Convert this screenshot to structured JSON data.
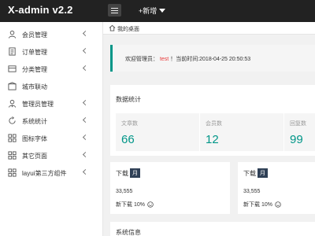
{
  "app": {
    "title": "X-admin v2.2",
    "add_new_label": "+新增"
  },
  "sidebar": {
    "items": [
      {
        "label": "会员管理",
        "icon": "user-icon"
      },
      {
        "label": "订单管理",
        "icon": "order-icon"
      },
      {
        "label": "分类管理",
        "icon": "category-icon"
      },
      {
        "label": "城市联动",
        "icon": "city-icon"
      },
      {
        "label": "管理员管理",
        "icon": "admin-icon"
      },
      {
        "label": "系统统计",
        "icon": "stats-icon"
      },
      {
        "label": "图标字体",
        "icon": "font-icon"
      },
      {
        "label": "其它页面",
        "icon": "pages-icon"
      },
      {
        "label": "layui第三方组件",
        "icon": "components-icon"
      }
    ]
  },
  "tabs": {
    "home_label": "我的桌面"
  },
  "welcome": {
    "prefix": "欢迎管理员：",
    "user": "test",
    "suffix": "！当前时间:2018-04-25 20:50:53"
  },
  "stats": {
    "title": "数据统计",
    "items": [
      {
        "label": "文章数",
        "value": "66"
      },
      {
        "label": "会员数",
        "value": "12"
      },
      {
        "label": "回复数",
        "value": "99"
      }
    ]
  },
  "downloads": [
    {
      "title": "下载",
      "badge": "月",
      "count": "33,555",
      "sub": "新下载 10%"
    },
    {
      "title": "下载",
      "badge": "月",
      "count": "33,555",
      "sub": "新下载 10%"
    }
  ],
  "system": {
    "title": "系统信息"
  },
  "colors": {
    "topbar": "#222222",
    "accent": "#009688",
    "badge": "#2f4056",
    "welcome_user": "#e83c3c"
  }
}
